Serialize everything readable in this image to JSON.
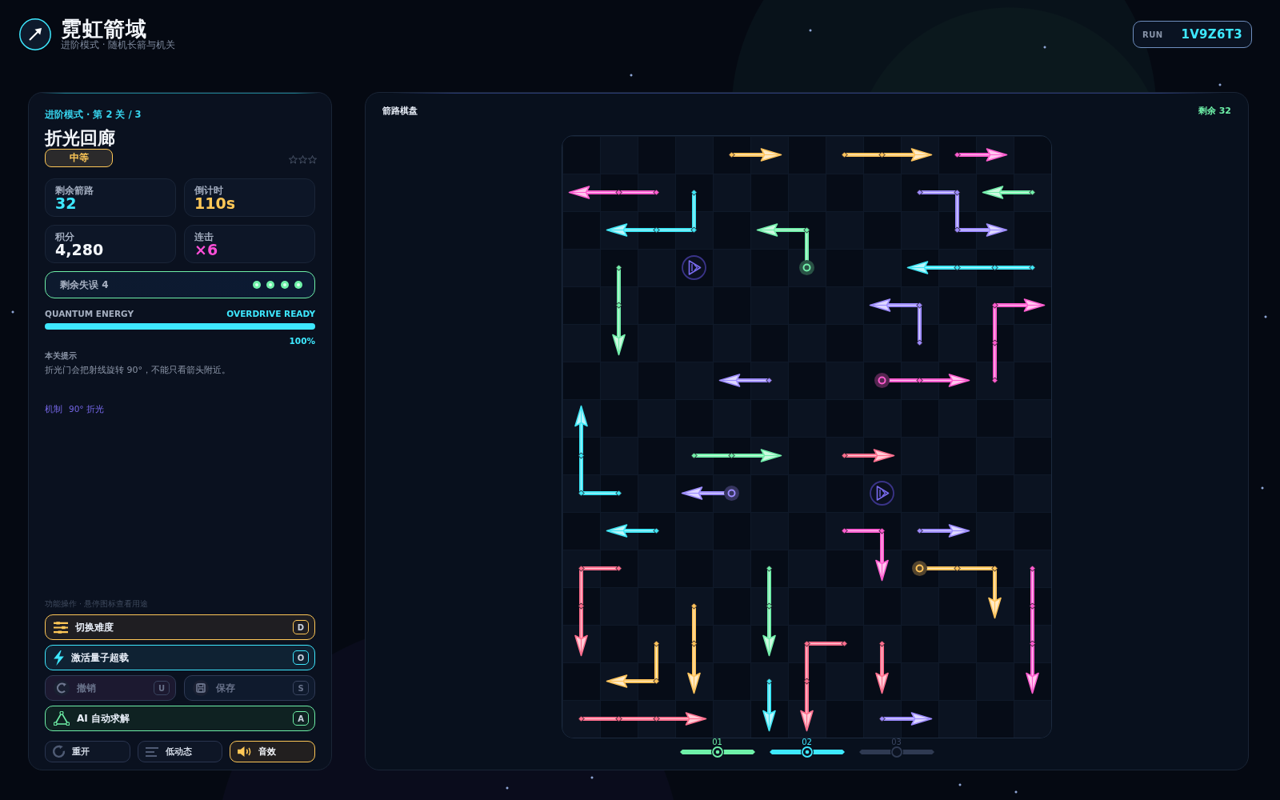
{
  "header": {
    "title": "霓虹箭域",
    "subtitle": "进阶模式 · 随机长箭与机关",
    "run_label": "RUN",
    "run_code": "1V9Z6T3"
  },
  "level_panel": {
    "breadcrumb": "进阶模式 · 第 2 关 / 3",
    "title": "折光回廊",
    "difficulty": "中等",
    "stars": 0,
    "stats": [
      {
        "label": "剩余箭路",
        "value": "32",
        "color": "#3ee8ff"
      },
      {
        "label": "倒计时",
        "value": "110s",
        "color": "#ffc857"
      },
      {
        "label": "积分",
        "value": "4,280",
        "color": "#f4f7fb"
      },
      {
        "label": "连击",
        "value": "×6",
        "color": "#ff4fd8"
      }
    ],
    "mistakes": {
      "label": "剩余失误 4",
      "lives": [
        {
          "lit": true
        },
        {
          "lit": true
        },
        {
          "lit": true
        },
        {
          "lit": true
        }
      ]
    },
    "energy": {
      "label": "QUANTUM ENERGY",
      "status": "OVERDRIVE READY",
      "level": 1,
      "reading": "100%"
    },
    "hint": {
      "heading": "本关提示",
      "text": "折光门会把射线旋转 90°，不能只看箭头附近。"
    },
    "mechanic": {
      "label": "机制",
      "value": "90° 折光"
    },
    "actions_caption": "功能操作 · 悬停图标查看用途",
    "action_rows": [
      [
        {
          "kind": "difficulty",
          "label": "切换难度",
          "key": "D",
          "disabled": false
        }
      ],
      [
        {
          "kind": "overdrive",
          "label": "激活量子超载",
          "key": "O",
          "disabled": false
        }
      ],
      [
        {
          "kind": "undo",
          "label": "撤销",
          "key": "U",
          "disabled": true
        },
        {
          "kind": "save",
          "label": "保存",
          "key": "S",
          "disabled": true
        }
      ],
      [
        {
          "kind": "solve",
          "label": "AI 自动求解",
          "key": "A",
          "disabled": false
        }
      ]
    ],
    "toggles": [
      {
        "kind": "restart",
        "label": "重开",
        "on": false
      },
      {
        "kind": "motion",
        "label": "低动态",
        "on": false
      },
      {
        "kind": "sound",
        "label": "音效",
        "on": true
      }
    ]
  },
  "board": {
    "title": "箭路棋盘",
    "remaining": "剩余 32",
    "arrows": [
      {
        "color": "#ffc45c",
        "kind": "plain"
      },
      {
        "color": "#ffc45c",
        "kind": "plain"
      },
      {
        "color": "#ff5ccf",
        "kind": "plain"
      },
      {
        "color": "#ff5ccf",
        "kind": "plain"
      },
      {
        "color": "#3fe6f5",
        "kind": "plain"
      },
      {
        "color": "#9d8cff",
        "kind": "plain"
      },
      {
        "color": "#72eeaa",
        "kind": "plain"
      },
      {
        "color": "#72eeaa",
        "kind": "ringed"
      },
      {
        "color": "#3fe6f5",
        "kind": "plain"
      },
      {
        "color": "#72eeaa",
        "kind": "plain"
      },
      {
        "color": "#9d8cff",
        "kind": "plain"
      },
      {
        "color": "#ff5ccf",
        "kind": "plain"
      },
      {
        "color": "#9d8cff",
        "kind": "plain"
      },
      {
        "color": "#ff5ccf",
        "kind": "ringed"
      },
      {
        "color": "#3fe6f5",
        "kind": "plain"
      },
      {
        "color": "#72eeaa",
        "kind": "plain"
      },
      {
        "color": "#ff6f8e",
        "kind": "plain"
      },
      {
        "color": "#9d8cff",
        "kind": "ringed"
      },
      {
        "color": "#3fe6f5",
        "kind": "plain"
      },
      {
        "color": "#ff5ccf",
        "kind": "plain"
      },
      {
        "color": "#9d8cff",
        "kind": "plain"
      },
      {
        "color": "#ff6f8e",
        "kind": "plain"
      },
      {
        "color": "#72eeaa",
        "kind": "plain"
      },
      {
        "color": "#ffc45c",
        "kind": "ringed"
      },
      {
        "color": "#ff5ccf",
        "kind": "plain"
      },
      {
        "color": "#ffc45c",
        "kind": "plain"
      },
      {
        "color": "#ffc45c",
        "kind": "plain"
      },
      {
        "color": "#ff6f8e",
        "kind": "plain"
      },
      {
        "color": "#ff6f8e",
        "kind": "plain"
      },
      {
        "color": "#3fe6f5",
        "kind": "plain"
      },
      {
        "color": "#ff6f8e",
        "kind": "plain"
      },
      {
        "color": "#9d8cff",
        "kind": "plain"
      }
    ],
    "gates": [
      {
        "kind": "refract"
      },
      {
        "kind": "refract"
      }
    ],
    "levels": [
      {
        "label": "01",
        "cleared": true,
        "selected": false
      },
      {
        "label": "02",
        "cleared": false,
        "selected": true
      },
      {
        "label": "03",
        "cleared": false,
        "selected": false
      }
    ]
  }
}
